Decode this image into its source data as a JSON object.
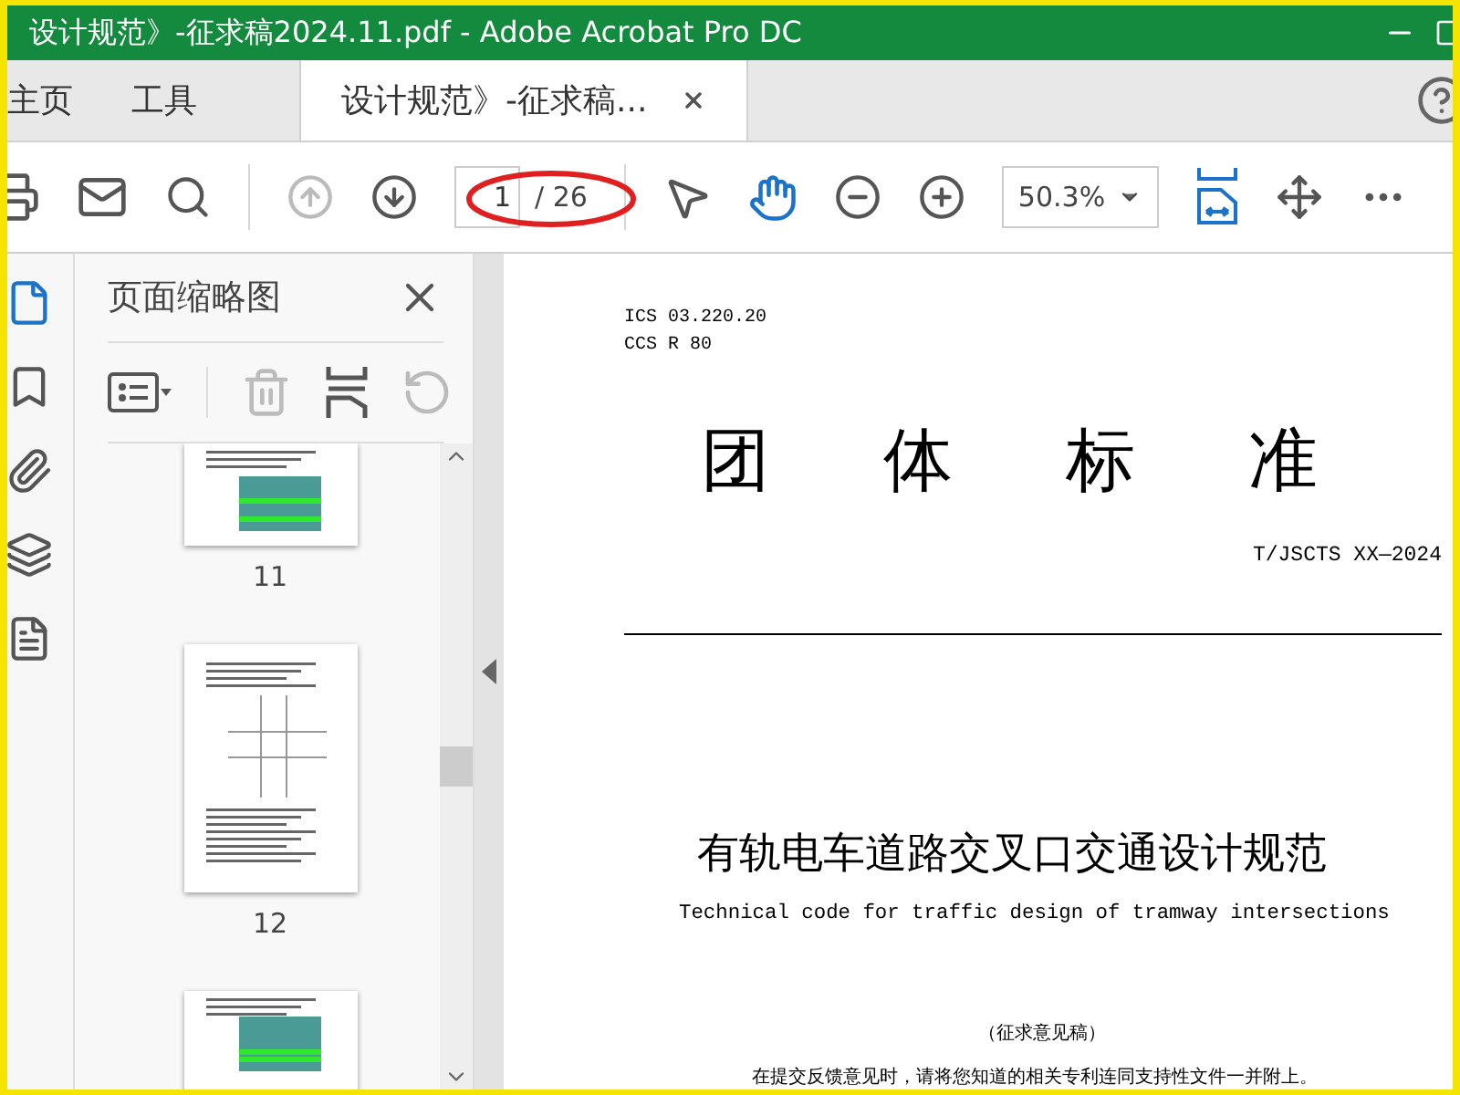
{
  "window": {
    "title": "设计规范》-征求稿2024.11.pdf - Adobe Acrobat Pro DC"
  },
  "tabs": [
    {
      "label": "主页",
      "selected": false,
      "kind": "nav"
    },
    {
      "label": "工具",
      "selected": false,
      "kind": "nav"
    },
    {
      "label": "设计规范》-征求稿...",
      "selected": true,
      "kind": "document"
    }
  ],
  "toolbar": {
    "nav": [
      {
        "kind": "prev",
        "disabled": true
      },
      {
        "kind": "next",
        "disabled": false
      }
    ],
    "page": {
      "current": "1",
      "total": "/ 26"
    },
    "tools": [
      {
        "kind": "pointer",
        "selected": false
      },
      {
        "kind": "hand",
        "selected": true
      }
    ],
    "zoom": "50.3%"
  },
  "rail": [
    {
      "kind": "pages",
      "selected": true
    },
    {
      "kind": "bookmarks",
      "selected": false
    },
    {
      "kind": "attachments",
      "selected": false
    },
    {
      "kind": "layers",
      "selected": false
    },
    {
      "kind": "content",
      "selected": false
    }
  ],
  "panel": {
    "title": "页面缩略图",
    "tools": [
      {
        "kind": "options",
        "disabled": false
      },
      {
        "kind": "delete",
        "disabled": true
      },
      {
        "kind": "insert",
        "disabled": false
      },
      {
        "kind": "undo",
        "disabled": true
      }
    ],
    "thumbnails": [
      {
        "kind": "table",
        "label": "11"
      },
      {
        "kind": "diagram",
        "label": "12"
      },
      {
        "kind": "table"
      }
    ]
  },
  "document": {
    "ics": "ICS 03.220.20",
    "ccs": "CCS R 80",
    "heading": "团 体 标 准",
    "code": "T/JSCTS XX—2024",
    "title": "有轨电车道路交叉口交通设计规范",
    "subtitle": "Technical code for traffic design of tramway intersections",
    "draft": "（征求意见稿）",
    "notice": "在提交反馈意见时，请将您知道的相关专利连同支持性文件一并附上。"
  }
}
